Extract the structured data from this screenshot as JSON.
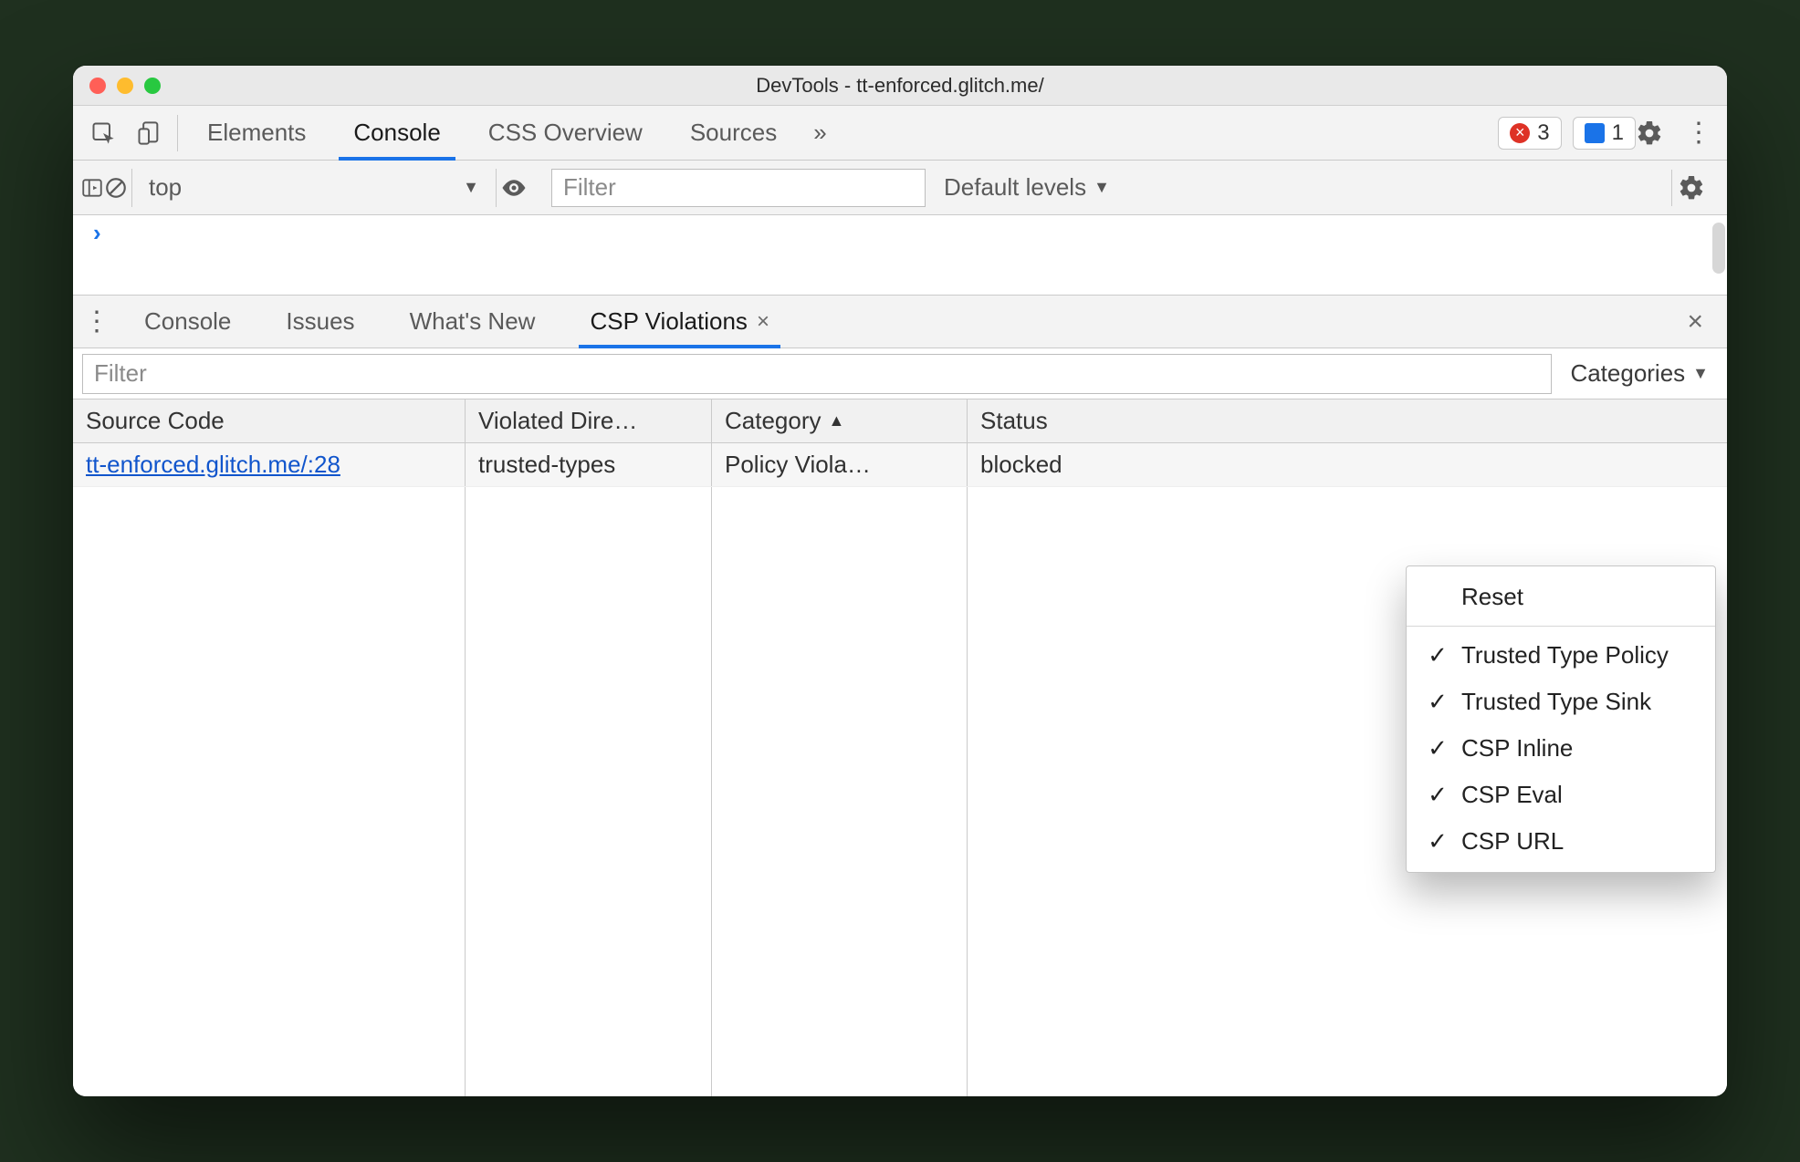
{
  "window": {
    "title": "DevTools - tt-enforced.glitch.me/"
  },
  "topTabs": {
    "items": [
      "Elements",
      "Console",
      "CSS Overview",
      "Sources"
    ],
    "active": "Console",
    "more": "»",
    "errors": "3",
    "messages": "1"
  },
  "consoleBar": {
    "context": "top",
    "filter_placeholder": "Filter",
    "levels": "Default levels"
  },
  "drawer": {
    "items": [
      "Console",
      "Issues",
      "What's New",
      "CSP Violations"
    ],
    "active": "CSP Violations"
  },
  "violationsFilter": {
    "placeholder": "Filter",
    "categories_label": "Categories"
  },
  "table": {
    "headers": {
      "source": "Source Code",
      "directive": "Violated Dire…",
      "category": "Category",
      "status": "Status"
    },
    "rows": [
      {
        "source": "tt-enforced.glitch.me/:28",
        "directive": "trusted-types",
        "category": "Policy Viola…",
        "status": "blocked"
      }
    ]
  },
  "categoriesMenu": {
    "reset": "Reset",
    "items": [
      "Trusted Type Policy",
      "Trusted Type Sink",
      "CSP Inline",
      "CSP Eval",
      "CSP URL"
    ]
  }
}
